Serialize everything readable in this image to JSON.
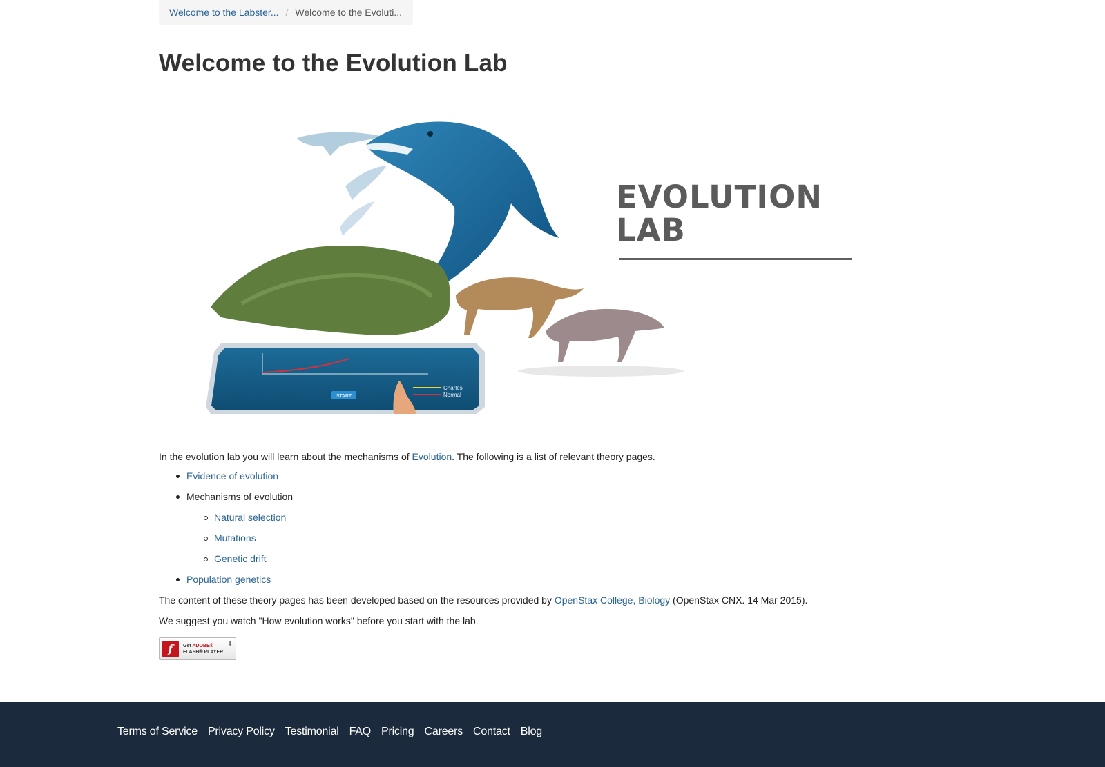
{
  "breadcrumb": {
    "items": [
      {
        "label": "Welcome to the Labster..."
      },
      {
        "label": "Welcome to the Evoluti..."
      }
    ],
    "separator": "/"
  },
  "page": {
    "title": "Welcome to the Evolution Lab"
  },
  "hero": {
    "title_line1": "EVOLUTION",
    "title_line2": "LAB",
    "chart_legend": [
      "Charles",
      "Normal"
    ],
    "chart_button": "START"
  },
  "content": {
    "intro_before": "In the evolution lab you will learn about the mechanisms of ",
    "intro_link": "Evolution",
    "intro_after": ". The following is a list of relevant theory pages.",
    "list": {
      "evidence": "Evidence of evolution",
      "mechanisms": "Mechanisms of evolution",
      "natural_selection": "Natural selection",
      "mutations": "Mutations",
      "genetic_drift": "Genetic drift",
      "population_genetics": "Population genetics"
    },
    "credit_before": "The content of these theory pages has been developed based on the resources provided by ",
    "credit_link": "OpenStax College, Biology",
    "credit_after": " (OpenStax CNX. 14 Mar 2015).",
    "suggestion": "We suggest you watch \"How evolution works\" before you start with the lab."
  },
  "flash": {
    "line1_get": "Get ",
    "line1_adobe": "ADOBE®",
    "line2": "FLASH® PLAYER"
  },
  "footer": {
    "links": [
      "Terms of Service",
      "Privacy Policy",
      "Testimonial",
      "FAQ",
      "Pricing",
      "Careers",
      "Contact",
      "Blog"
    ]
  },
  "colors": {
    "link": "#2a6496",
    "footer_bg": "#1b2a3c",
    "hero_text": "#5b5b5b"
  }
}
